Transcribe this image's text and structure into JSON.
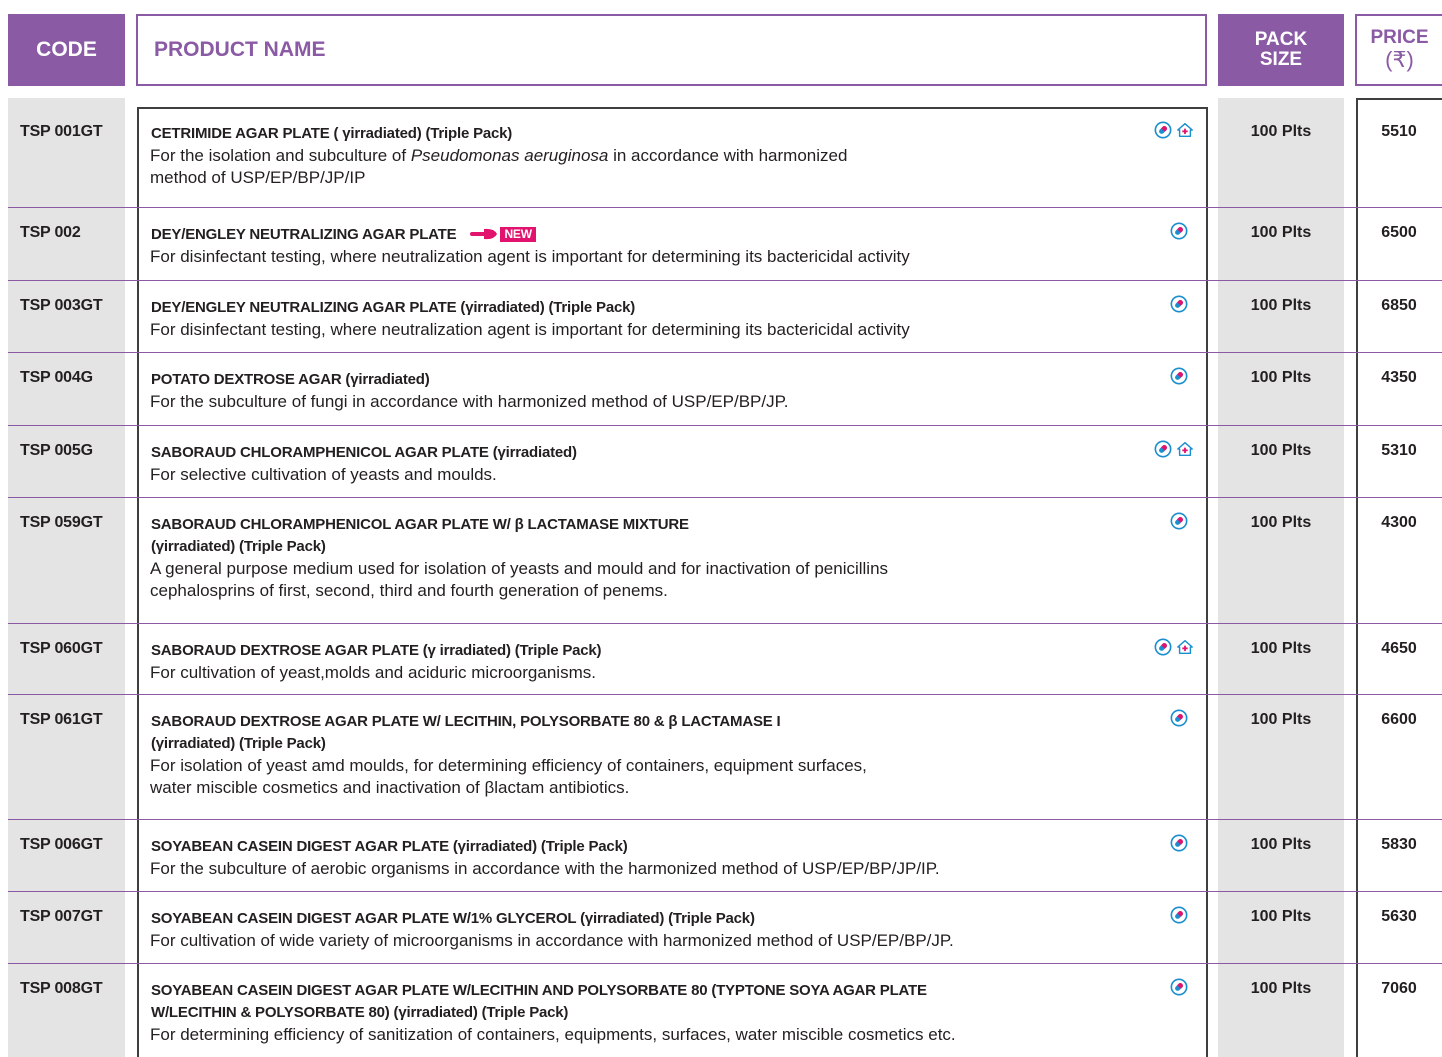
{
  "header": {
    "code": "CODE",
    "product_name": "PRODUCT NAME",
    "pack_line1": "PACK",
    "pack_line2": "SIZE",
    "price_line1": "PRICE",
    "price_line2": "(₹)"
  },
  "colors": {
    "accent": "#8a5aa5",
    "band": "#e4e4e4",
    "new": "#e2136e",
    "icon_blue": "#1a8ecf"
  },
  "badge": {
    "new_label": "NEW"
  },
  "rows": [
    {
      "code": "TSP 001GT",
      "title": "CETRIMIDE AGAR PLATE ( γirradiated) (Triple Pack)",
      "desc_pre": "For the isolation and subculture of ",
      "desc_italic": "Pseudomonas aeruginosa",
      "desc_post": "  in accordance with harmonized",
      "desc_line2": " method of USP/EP/BP/JP/IP",
      "pack": "100 Plts",
      "price": "5510",
      "icons": [
        "pharma-icon",
        "hospital-icon"
      ]
    },
    {
      "code": "TSP 002",
      "title": "DEY/ENGLEY NEUTRALIZING AGAR PLATE",
      "desc": "For disinfectant testing, where neutralization agent is important for determining its bactericidal activity",
      "pack": "100 Plts",
      "price": "6500",
      "icons": [
        "pharma-icon"
      ],
      "new": true
    },
    {
      "code": "TSP 003GT",
      "title": "DEY/ENGLEY NEUTRALIZING AGAR PLATE (γirradiated) (Triple Pack)",
      "desc": "For disinfectant testing, where neutralization agent is important for determining its bactericidal activity",
      "pack": "100 Plts",
      "price": "6850",
      "icons": [
        "pharma-icon"
      ]
    },
    {
      "code": "TSP 004G",
      "title": "POTATO DEXTROSE AGAR (γirradiated)",
      "desc": "For the subculture of fungi in accordance with harmonized method of USP/EP/BP/JP.",
      "pack": "100 Plts",
      "price": "4350",
      "icons": [
        "pharma-icon"
      ]
    },
    {
      "code": "TSP 005G",
      "title": "SABORAUD CHLORAMPHENICOL AGAR PLATE (γirradiated)",
      "desc": "For selective cultivation of yeasts and moulds.",
      "pack": "100 Plts",
      "price": "5310",
      "icons": [
        "pharma-icon",
        "hospital-icon"
      ]
    },
    {
      "code": "TSP 059GT",
      "title": "SABORAUD CHLORAMPHENICOL AGAR PLATE W/  β LACTAMASE MIXTURE",
      "title2": "(γirradiated) (Triple Pack)",
      "desc": "A general purpose medium used for isolation of yeasts and mould and for inactivation of penicillins",
      "desc_line2": "cephalosprins of first, second, third and fourth generation of penems.",
      "pack": "100 Plts",
      "price": "4300",
      "icons": [
        "pharma-icon"
      ]
    },
    {
      "code": "TSP 060GT",
      "title": "SABORAUD DEXTROSE AGAR PLATE (γ irradiated) (Triple Pack)",
      "desc": "For cultivation of yeast,molds and aciduric microorganisms.",
      "pack": "100 Plts",
      "price": "4650",
      "icons": [
        "pharma-icon",
        "hospital-icon"
      ]
    },
    {
      "code": "TSP 061GT",
      "title": "SABORAUD DEXTROSE AGAR PLATE W/ LECITHIN, POLYSORBATE 80 & β LACTAMASE I",
      "title2": "(γirradiated) (Triple Pack)",
      "desc": "For isolation of yeast amd moulds, for determining efficiency of containers, equipment surfaces,",
      "desc_line2": "water miscible cosmetics and inactivation of βlactam antibiotics.",
      "pack": "100 Plts",
      "price": "6600",
      "icons": [
        "pharma-icon"
      ]
    },
    {
      "code": "TSP 006GT",
      "title": "SOYABEAN CASEIN DIGEST AGAR PLATE (γirradiated) (Triple Pack)",
      "desc": "For the subculture of aerobic organisms in accordance with the harmonized method of USP/EP/BP/JP/IP.",
      "pack": "100 Plts",
      "price": "5830",
      "icons": [
        "pharma-icon"
      ]
    },
    {
      "code": "TSP 007GT",
      "title": "SOYABEAN CASEIN DIGEST AGAR PLATE W/1% GLYCEROL (γirradiated) (Triple Pack)",
      "desc": "For cultivation of wide variety of microorganisms in accordance with harmonized method of USP/EP/BP/JP.",
      "pack": "100 Plts",
      "price": "5630",
      "icons": [
        "pharma-icon"
      ]
    },
    {
      "code": "TSP 008GT",
      "title": "SOYABEAN CASEIN DIGEST AGAR PLATE W/LECITHIN AND POLYSORBATE 80 (TYPTONE SOYA AGAR PLATE",
      "title2": "W/LECITHIN & POLYSORBATE 80) (γirradiated) (Triple Pack)",
      "desc": "For determining efficiency of sanitization of containers, equipments, surfaces, water miscible cosmetics etc.",
      "pack": "100 Plts",
      "price": "7060",
      "icons": [
        "pharma-icon"
      ]
    }
  ]
}
